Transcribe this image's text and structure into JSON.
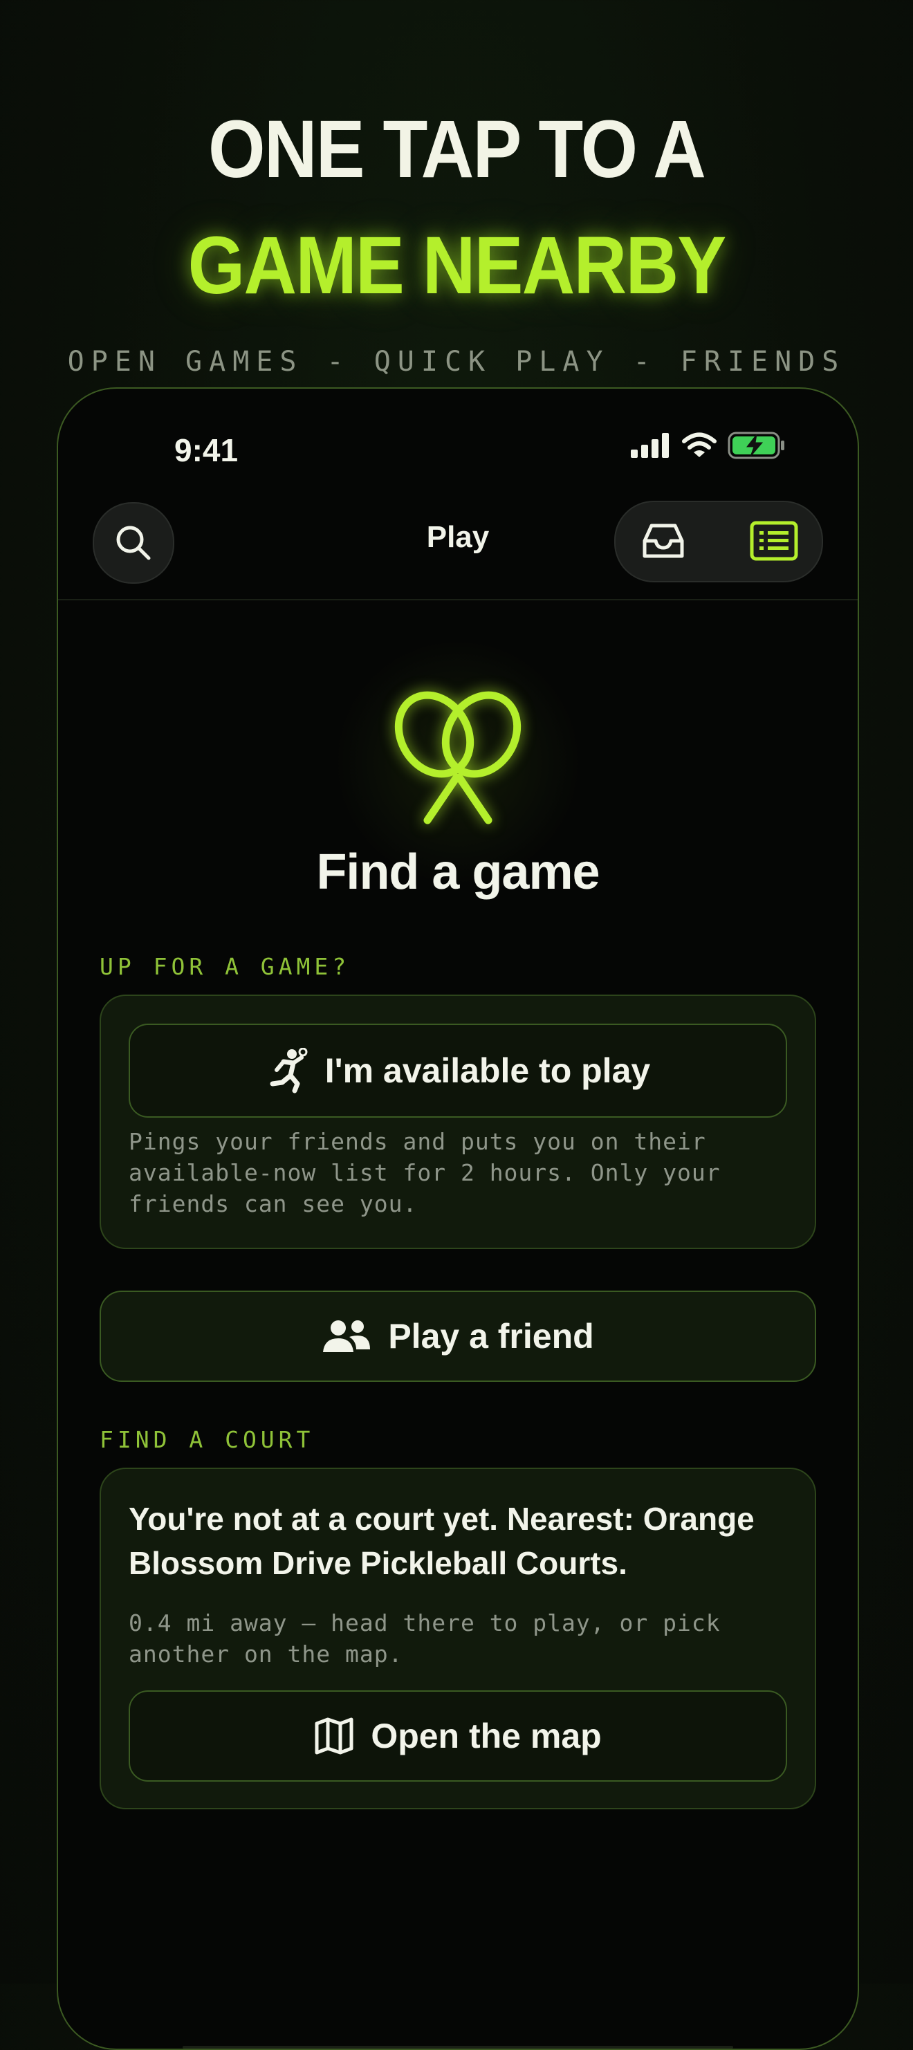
{
  "hero": {
    "line1": "ONE TAP TO A",
    "line2": "GAME NEARBY",
    "subtitle": "OPEN GAMES - QUICK PLAY - FRIENDS"
  },
  "status_bar": {
    "time": "9:41",
    "icons": [
      "cellular-signal-icon",
      "wifi-icon",
      "battery-charging-icon"
    ]
  },
  "header": {
    "title": "Play",
    "left_button_icon": "search-icon",
    "right_group_icons": [
      "inbox-icon",
      "list-view-icon"
    ],
    "active_view": "list-view-icon"
  },
  "main": {
    "logo_icon": "crossed-paddles-icon",
    "title": "Find a game",
    "availability_section": {
      "label": "UP FOR A GAME?",
      "button_label": "I'm available to play",
      "button_icon": "player-running-icon",
      "description": "Pings your friends and puts you on their available-now list for 2 hours. Only your friends can see you."
    },
    "play_friend": {
      "button_label": "Play a friend",
      "button_icon": "people-icon"
    },
    "court_section": {
      "label": "FIND A COURT",
      "heading": "You're not at a court yet. Nearest: Orange Blossom Drive Pickleball Courts.",
      "detail": "0.4 mi away — head there to play, or pick another on the map.",
      "button_label": "Open the map",
      "button_icon": "map-icon"
    }
  },
  "colors": {
    "accent": "#b4ef2c",
    "background": "#050605",
    "card": "#111a0c",
    "card_border": "#2d451b",
    "label_green": "#8fc238",
    "battery_green": "#3fd157"
  }
}
